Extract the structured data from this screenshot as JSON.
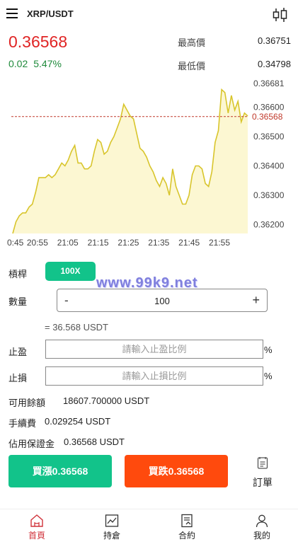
{
  "header": {
    "title": "XRP/USDT"
  },
  "ticker": {
    "price": "0.36568",
    "change_abs": "0.02",
    "change_pct": "5.47%",
    "high_label": "最高價",
    "high_value": "0.36751",
    "low_label": "最低價",
    "low_value": "0.34798"
  },
  "chart_data": {
    "type": "area",
    "x_ticks": [
      "0:45",
      "20:55",
      "21:05",
      "21:15",
      "21:25",
      "21:35",
      "21:45",
      "21:55"
    ],
    "y_ticks": [
      "0.36681",
      "0.36600",
      "0.36500",
      "0.36400",
      "0.36300",
      "0.36200"
    ],
    "current_price_label": "0.36568",
    "ylim": [
      0.3617,
      0.367
    ],
    "values": [
      0.3617,
      0.3621,
      0.3623,
      0.3624,
      0.3624,
      0.3626,
      0.3627,
      0.3631,
      0.3636,
      0.3636,
      0.3636,
      0.3637,
      0.3636,
      0.3637,
      0.3639,
      0.3641,
      0.364,
      0.3642,
      0.3645,
      0.3647,
      0.3641,
      0.3641,
      0.3639,
      0.3639,
      0.364,
      0.3645,
      0.3649,
      0.3648,
      0.3644,
      0.3645,
      0.3648,
      0.365,
      0.3653,
      0.3656,
      0.3661,
      0.3659,
      0.3657,
      0.3656,
      0.3651,
      0.3646,
      0.3645,
      0.3643,
      0.364,
      0.3638,
      0.3635,
      0.3633,
      0.3636,
      0.3634,
      0.363,
      0.3639,
      0.3633,
      0.363,
      0.3627,
      0.3627,
      0.363,
      0.3637,
      0.364,
      0.364,
      0.3639,
      0.3634,
      0.3633,
      0.3638,
      0.3648,
      0.3652,
      0.3666,
      0.3665,
      0.3658,
      0.3664,
      0.3659,
      0.3662,
      0.3655,
      0.3658,
      0.3657
    ],
    "line_color": "#d8c52c",
    "fill_color": "#fcf7d2",
    "ref_line_color": "#c0392b",
    "grid": false
  },
  "trade": {
    "leverage_label": "槓桿",
    "leverage_value": "100X",
    "qty_label": "數量",
    "qty_minus": "-",
    "qty_value": "100",
    "qty_plus": "+",
    "equiv": "= 36.568 USDT",
    "tp_label": "止盈",
    "tp_placeholder": "請輸入止盈比例",
    "sl_label": "止損",
    "sl_placeholder": "請輸入止損比例",
    "pct": "%"
  },
  "info": {
    "balance_label": "可用餘額",
    "balance_value": "18607.700000 USDT",
    "fee_label": "手續費",
    "fee_value": "0.029254 USDT",
    "margin_label": "佔用保證金",
    "margin_value": "0.36568 USDT"
  },
  "actions": {
    "buy_up": "買漲0.36568",
    "buy_down": "買跌0.36568",
    "orders": "訂單"
  },
  "nav": {
    "home": "首頁",
    "positions": "持倉",
    "contract": "合約",
    "mine": "我的"
  },
  "watermark": "www.99k9.net",
  "colors": {
    "green": "#12c38a",
    "red": "#ff4a0d",
    "price_red": "#e02424",
    "active_nav": "#d0323a"
  }
}
